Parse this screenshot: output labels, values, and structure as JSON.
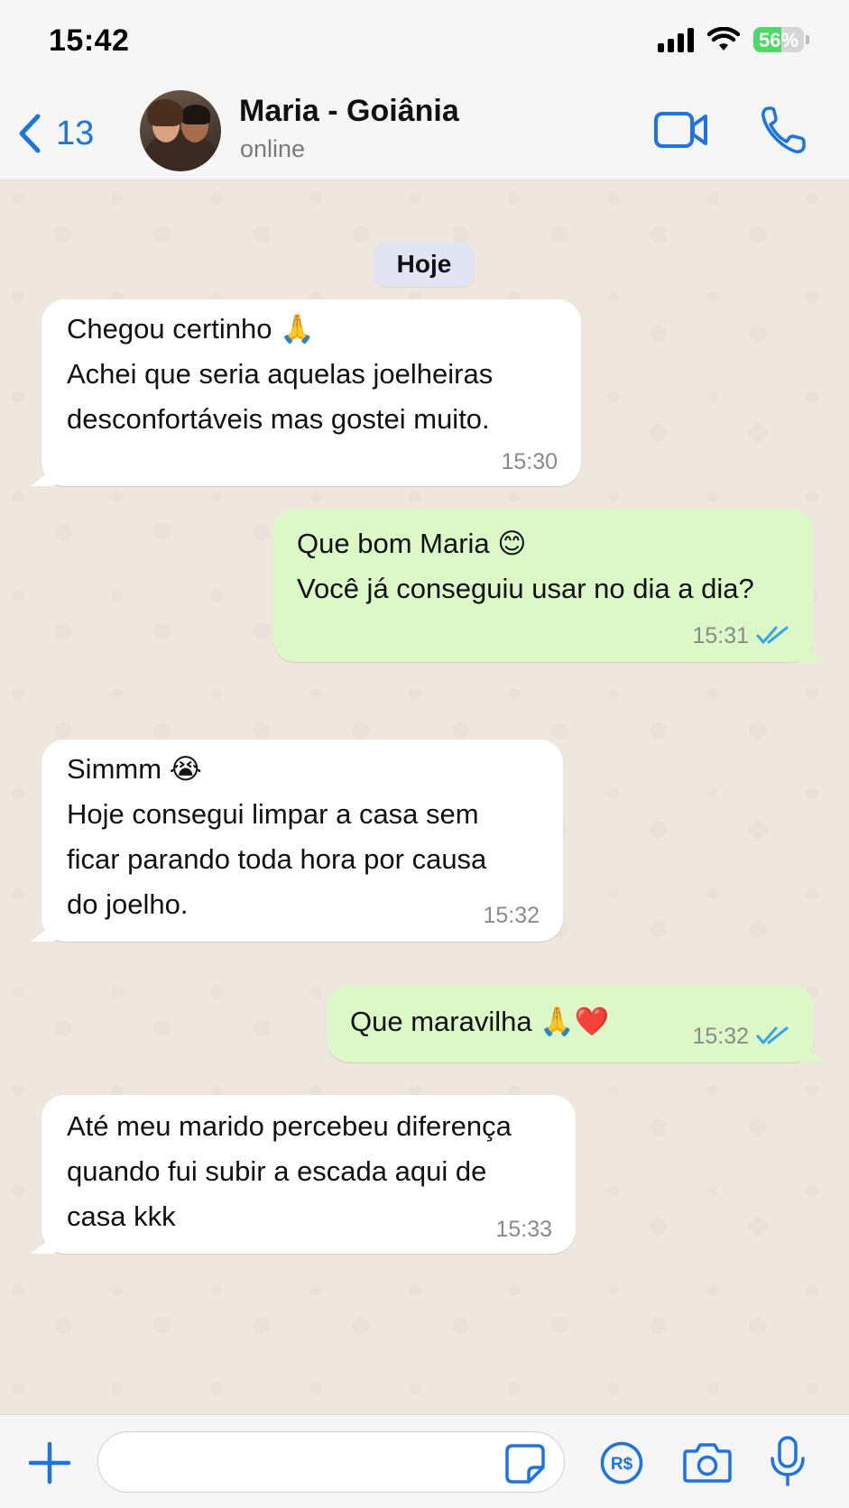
{
  "status_bar": {
    "time": "15:42",
    "battery_text": "56%",
    "battery_level": 0.56,
    "battery_color": "#4cd964"
  },
  "header": {
    "back_count": "13",
    "contact_name": "Maria - Goiânia",
    "contact_status": "online",
    "accent_color": "#1a73e8",
    "icons": [
      "chevron-left-icon",
      "video-camera-icon",
      "phone-icon"
    ]
  },
  "chat": {
    "date_label": "Hoje",
    "incoming_color": "#ffffff",
    "outgoing_color": "#dcf8c6",
    "messages": [
      {
        "direction": "in",
        "lines": [
          "Chegou certinho 🙏",
          "Achei que seria aquelas joelheiras",
          "desconfortáveis mas gostei muito."
        ],
        "time": "15:30"
      },
      {
        "direction": "out",
        "lines": [
          "Que bom Maria 😊",
          "Você já conseguiu usar no dia a dia?"
        ],
        "time": "15:31",
        "status": "read"
      },
      {
        "direction": "in",
        "lines": [
          "Simmm 😭",
          "Hoje consegui limpar a casa sem",
          "ficar parando toda hora por causa",
          "do joelho."
        ],
        "time": "15:32"
      },
      {
        "direction": "out",
        "lines": [
          "Que maravilha 🙏❤️"
        ],
        "time": "15:32",
        "status": "read"
      },
      {
        "direction": "in",
        "lines": [
          "Até meu marido percebeu diferença",
          "quando fui subir a escada aqui de",
          "casa kkk"
        ],
        "time": "15:33"
      }
    ]
  },
  "input_bar": {
    "message_value": "",
    "icons": [
      "plus-icon",
      "sticker-icon",
      "payment-icon",
      "camera-icon",
      "microphone-icon"
    ]
  }
}
